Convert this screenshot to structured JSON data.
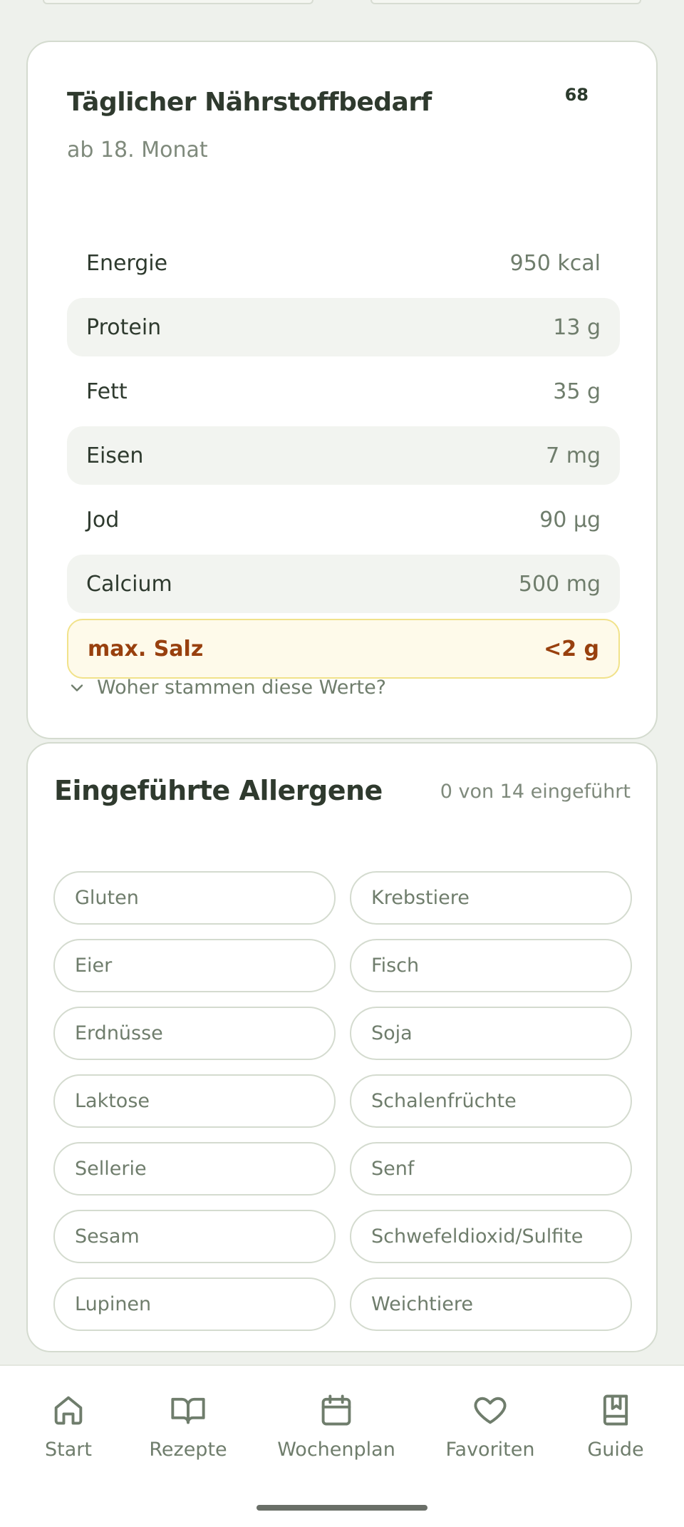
{
  "nutrition": {
    "badge": "68",
    "title": "Täglicher Nährstoffbedarf",
    "subtitle": "ab 18. Monat",
    "rows": [
      {
        "label": "Energie",
        "value": "950 kcal"
      },
      {
        "label": "Protein",
        "value": "13 g"
      },
      {
        "label": "Fett",
        "value": "35 g"
      },
      {
        "label": "Eisen",
        "value": "7 mg"
      },
      {
        "label": "Jod",
        "value": "90 µg"
      },
      {
        "label": "Calcium",
        "value": "500 mg"
      }
    ],
    "salt": {
      "label": "max. Salz",
      "value": "<2 g"
    },
    "source_toggle": "Woher stammen diese Werte?"
  },
  "allergens": {
    "title": "Eingeführte Allergene",
    "count": "0 von 14 eingeführt",
    "items": [
      "Gluten",
      "Krebstiere",
      "Eier",
      "Fisch",
      "Erdnüsse",
      "Soja",
      "Laktose",
      "Schalenfrüchte",
      "Sellerie",
      "Senf",
      "Sesam",
      "Schwefeldioxid/Sulfite",
      "Lupinen",
      "Weichtiere"
    ]
  },
  "nav": {
    "items": [
      {
        "label": "Start",
        "icon": "home-icon"
      },
      {
        "label": "Rezepte",
        "icon": "book-open-icon"
      },
      {
        "label": "Wochenplan",
        "icon": "calendar-icon"
      },
      {
        "label": "Favoriten",
        "icon": "heart-icon"
      },
      {
        "label": "Guide",
        "icon": "bookmark-book-icon"
      }
    ]
  },
  "colors": {
    "background": "#eef1ec",
    "card": "#ffffff",
    "text_primary": "#2f3a2e",
    "text_muted": "#6f7d6c",
    "salt_bg": "#fefaea",
    "salt_border": "#f1e28a",
    "salt_text": "#98400e"
  }
}
